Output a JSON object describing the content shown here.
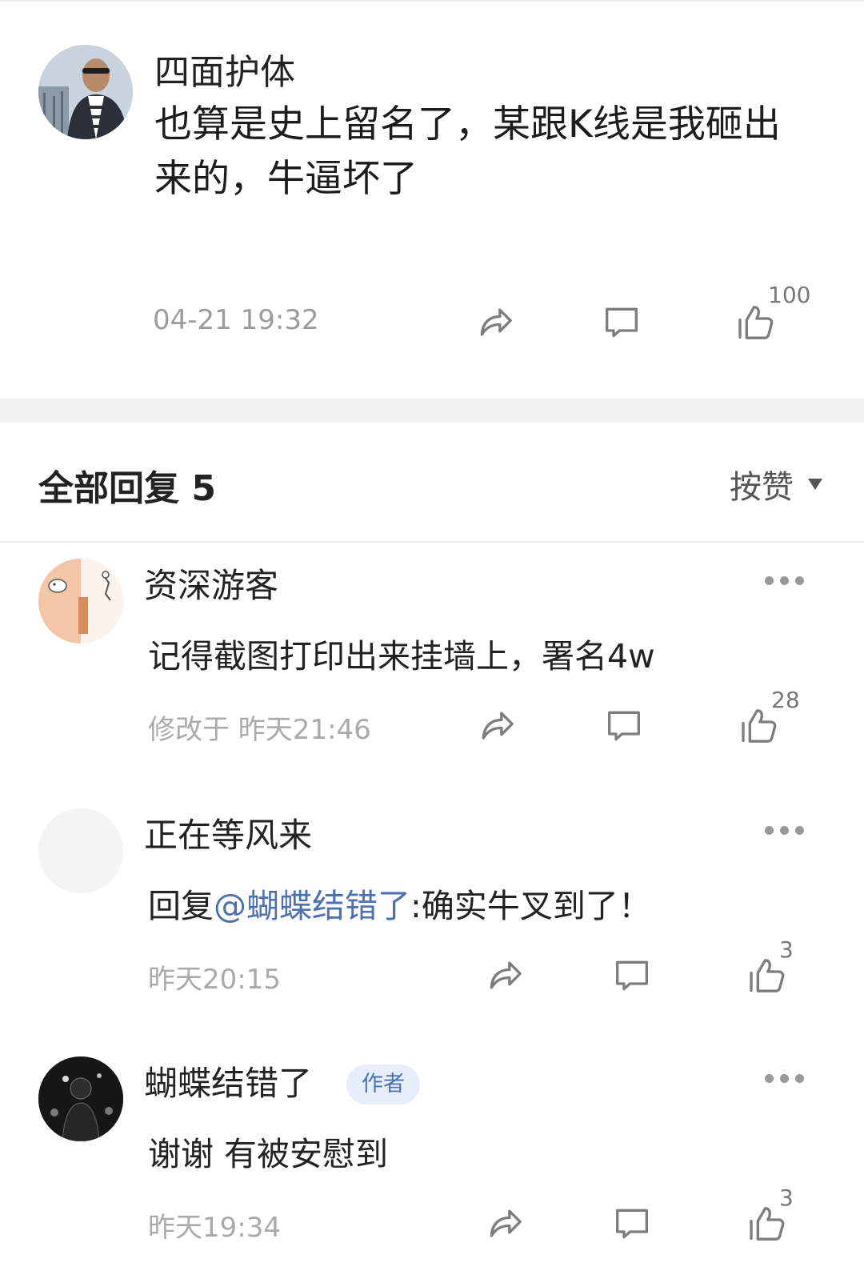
{
  "post": {
    "author": "四面护体",
    "text": "也算是史上留名了，某跟K线是我砸出来的，牛逼坏了",
    "time": "04-21 19:32",
    "likes": "100"
  },
  "replies_header": {
    "title": "全部回复 5",
    "sort_label": "按赞"
  },
  "replies": [
    {
      "author": "资深游客",
      "text": "记得截图打印出来挂墙上，署名4w",
      "time": "修改于 昨天21:46",
      "likes": "28"
    },
    {
      "author": "正在等风来",
      "text_prefix": "回复",
      "mention": "@蝴蝶结错了",
      "text_suffix": ":确实牛叉到了！",
      "time": "昨天20:15",
      "likes": "3"
    },
    {
      "author": "蝴蝶结错了",
      "badge": "作者",
      "text": "谢谢 有被安慰到",
      "time": "昨天19:34",
      "likes": "3"
    }
  ],
  "colors": {
    "mention": "#4d6fb4",
    "badge_bg": "#e7eefb",
    "secondary_text": "#9c9c9c",
    "section_band": "#f2f2f2"
  },
  "icons": [
    "share-icon",
    "comment-icon",
    "thumbs-up-icon",
    "more-icon",
    "sort-dropdown-icon"
  ]
}
